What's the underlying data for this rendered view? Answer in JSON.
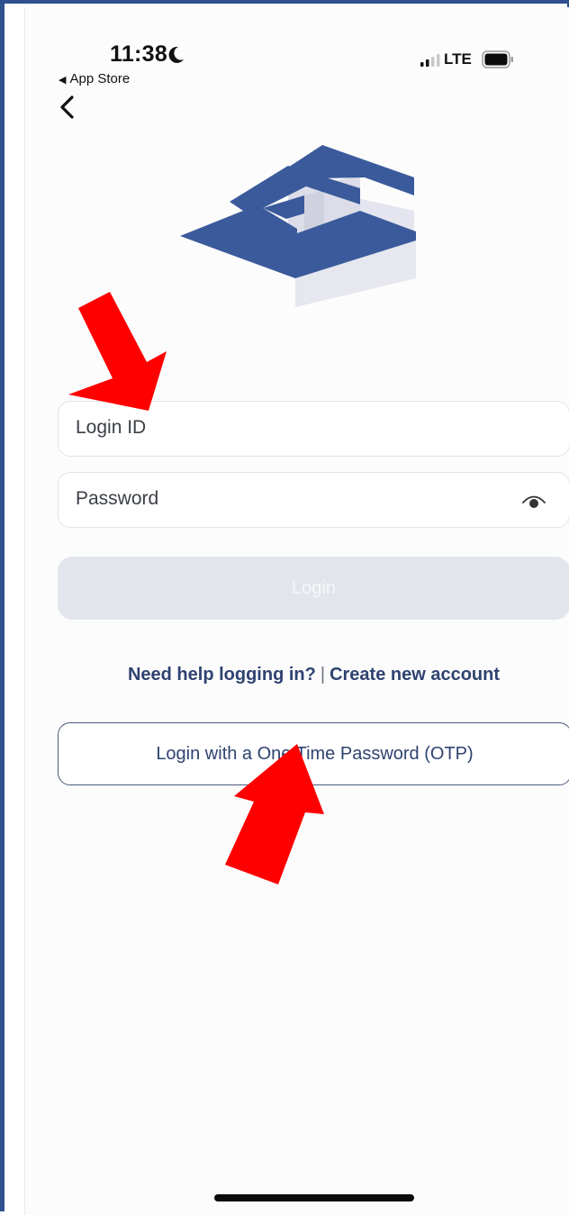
{
  "status_bar": {
    "time": "11:38",
    "back_app": "App Store",
    "network": "LTE"
  },
  "form": {
    "login_id_placeholder": "Login ID",
    "password_placeholder": "Password",
    "login_label": "Login"
  },
  "links": {
    "need_help": "Need help logging in?",
    "separator": "|",
    "create_account": "Create new account"
  },
  "otp": {
    "label": "Login with a One Time Password (OTP)"
  },
  "colors": {
    "brand": "#3a5a9b",
    "link": "#2f4270",
    "disabled_button": "#e2e6ec",
    "annotation_arrow": "#ff0000"
  },
  "icons": {
    "moon": "moon-icon",
    "signal": "signal-icon",
    "battery": "battery-icon",
    "back": "chevron-left-icon",
    "eye": "eye-icon"
  }
}
